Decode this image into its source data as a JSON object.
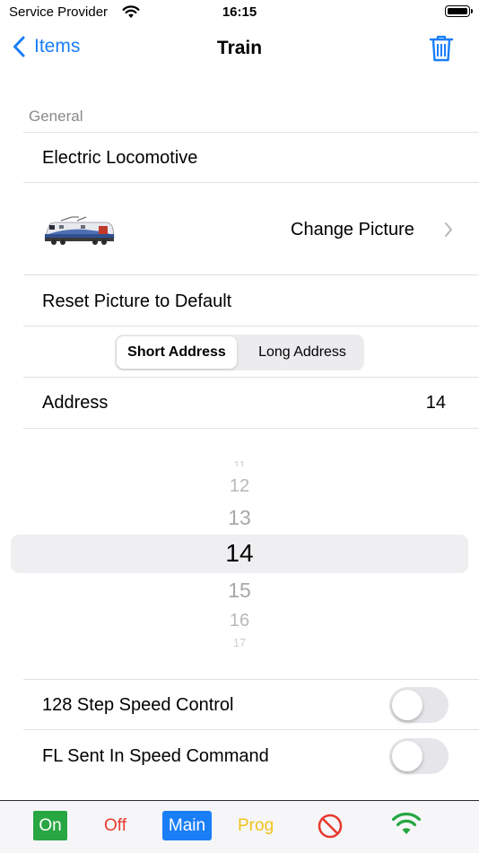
{
  "status_bar": {
    "carrier": "Service Provider",
    "time": "16:15"
  },
  "nav": {
    "back_label": "Items",
    "title": "Train",
    "trash_icon": "trash-icon"
  },
  "section": {
    "header": "General"
  },
  "rows": {
    "name": "Electric Locomotive",
    "change_picture": "Change Picture",
    "reset_picture": "Reset Picture to Default",
    "address_label": "Address",
    "address_value": "14",
    "step_speed": "128 Step Speed Control",
    "fl_sent": "FL Sent In Speed Command"
  },
  "segment": {
    "options": [
      "Short Address",
      "Long Address"
    ],
    "selected": "Short Address"
  },
  "picker": {
    "values": [
      "11",
      "12",
      "13",
      "14",
      "15",
      "16",
      "17"
    ],
    "selected": "14"
  },
  "toggles": {
    "step_speed_on": false,
    "fl_sent_on": false
  },
  "toolbar": {
    "on": "On",
    "off": "Off",
    "main": "Main",
    "prog": "Prog"
  },
  "colors": {
    "accent": "#1a7ef7",
    "on_green": "#27a642",
    "off_red": "#e83a30",
    "prog_yellow": "#f1c21b",
    "wifi_green": "#27a642"
  }
}
